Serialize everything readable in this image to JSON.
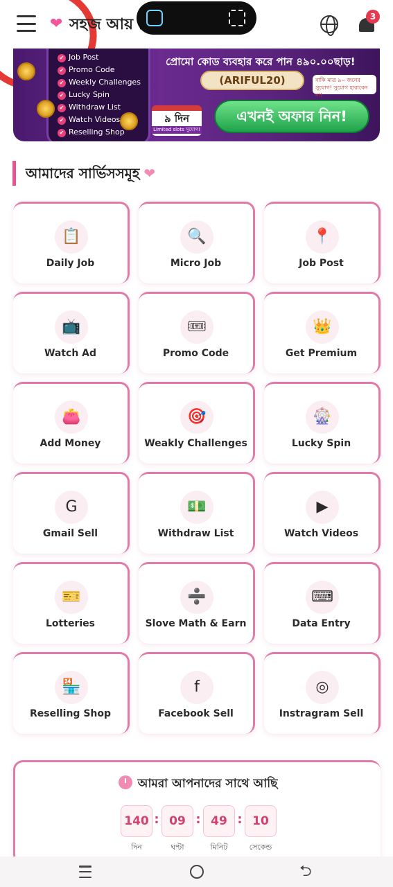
{
  "header": {
    "site_title": "সহজ আয় বিডি",
    "notification_count": "3"
  },
  "banner": {
    "features": [
      "Job Post",
      "Promo Code",
      "Weekly Challenges",
      "Lucky Spin",
      "Withdraw List",
      "Watch Videos",
      "Reselling Shop"
    ],
    "promo_text": "প্রোমো কোড ব্যবহার করে পান ৪৯০.০০ছাড়!",
    "promo_code": "(ARIFUL20)",
    "limited_note": "বাকি মাত্র ৯০ জনের সুযোগ! সুযোগ হারাবেন না!",
    "days": "৯ দিন",
    "slots": "Limited slots সুযোগ!",
    "offer_button": "এখনই অফার নিন!"
  },
  "services": {
    "title": "আমাদের সার্ভিসসমূহ",
    "items": [
      {
        "label": "Daily Job",
        "icon": "📋",
        "icon_name": "daily-job-icon"
      },
      {
        "label": "Micro Job",
        "icon": "🔍",
        "icon_name": "micro-job-icon"
      },
      {
        "label": "Job Post",
        "icon": "📍",
        "icon_name": "job-post-icon"
      },
      {
        "label": "Watch Ad",
        "icon": "📺",
        "icon_name": "watch-ad-icon"
      },
      {
        "label": "Promo Code",
        "icon": "🎟",
        "icon_name": "promo-code-icon"
      },
      {
        "label": "Get Premium",
        "icon": "👑",
        "icon_name": "premium-icon"
      },
      {
        "label": "Add Money",
        "icon": "👛",
        "icon_name": "wallet-icon"
      },
      {
        "label": "Weakly Challenges",
        "icon": "🎯",
        "icon_name": "target-icon"
      },
      {
        "label": "Lucky Spin",
        "icon": "🎡",
        "icon_name": "spin-wheel-icon"
      },
      {
        "label": "Gmail Sell",
        "icon": "G",
        "icon_name": "google-icon"
      },
      {
        "label": "Withdraw List",
        "icon": "💵",
        "icon_name": "withdraw-icon"
      },
      {
        "label": "Watch Videos",
        "icon": "▶",
        "icon_name": "video-play-icon"
      },
      {
        "label": "Lotteries",
        "icon": "🎫",
        "icon_name": "lottery-icon"
      },
      {
        "label": "Slove Math & Earn",
        "icon": "➗",
        "icon_name": "math-icon"
      },
      {
        "label": "Data Entry",
        "icon": "⌨",
        "icon_name": "keyboard-icon"
      },
      {
        "label": "Reselling Shop",
        "icon": "🏪",
        "icon_name": "shop-icon"
      },
      {
        "label": "Facebook Sell",
        "icon": "f",
        "icon_name": "facebook-icon"
      },
      {
        "label": "Instragram Sell",
        "icon": "◎",
        "icon_name": "instagram-icon"
      }
    ]
  },
  "countdown": {
    "title": "আমরা আপনাদের সাথে আছি",
    "days": "140",
    "hours": "09",
    "minutes": "49",
    "seconds": "10",
    "days_label": "দিন",
    "hours_label": "ঘণ্টা",
    "minutes_label": "মিনিট",
    "seconds_label": "সেকেন্ড"
  },
  "colors": {
    "accent": "#e25592",
    "countdown_text": "#d0426f",
    "offer_green": "#1fa34b",
    "banner_purple": "#5b247d"
  }
}
